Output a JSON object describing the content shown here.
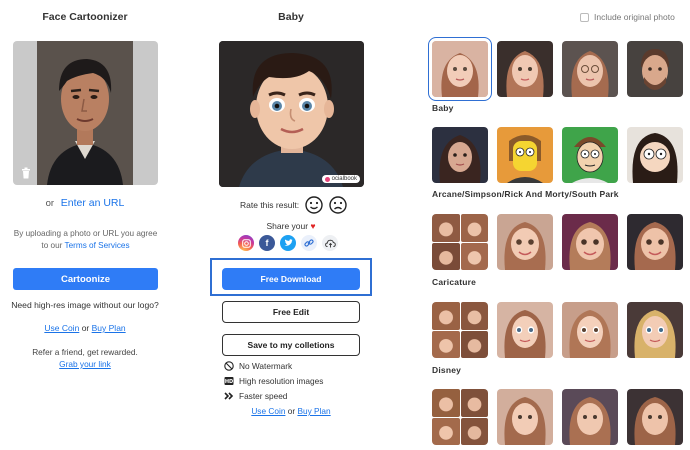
{
  "left": {
    "title": "Face Cartoonizer",
    "or_text": "or",
    "url_link": "Enter an URL",
    "terms_prefix": "By uploading a photo or URL you agree to our",
    "terms_link": "Terms of Services",
    "cartoonize_label": "Cartoonize",
    "hires_text": "Need high-res image without our logo?",
    "use_coin": "Use Coin",
    "or_word": "or",
    "buy_plan": "Buy Plan",
    "refer_text": "Refer a friend, get rewarded.",
    "grab_link": "Grab your link"
  },
  "middle": {
    "title": "Baby",
    "watermark": "ocialbook",
    "rate_label": "Rate this result:",
    "share_label": "Share your",
    "free_download": "Free Download",
    "free_edit": "Free Edit",
    "save_label": "Save to my colletions",
    "features": [
      "No Watermark",
      "High resolution images",
      "Faster speed"
    ],
    "use_coin": "Use Coin",
    "or_word": "or",
    "buy_plan": "Buy Plan"
  },
  "right": {
    "include_label": "Include original photo",
    "categories": [
      "Baby",
      "Arcane/Simpson/Rick And Morty/South Park",
      "Caricature",
      "Disney"
    ]
  },
  "colors": {
    "accent": "#2f7cf6",
    "link": "#1a73e8",
    "highlight": "#2f6fd3"
  },
  "icons": [
    "trash-icon",
    "smile-icon",
    "frown-icon",
    "instagram-icon",
    "facebook-icon",
    "twitter-icon",
    "link-icon",
    "cloud-upload-icon",
    "no-watermark-icon",
    "high-res-icon",
    "fast-forward-icon",
    "heart-icon"
  ]
}
